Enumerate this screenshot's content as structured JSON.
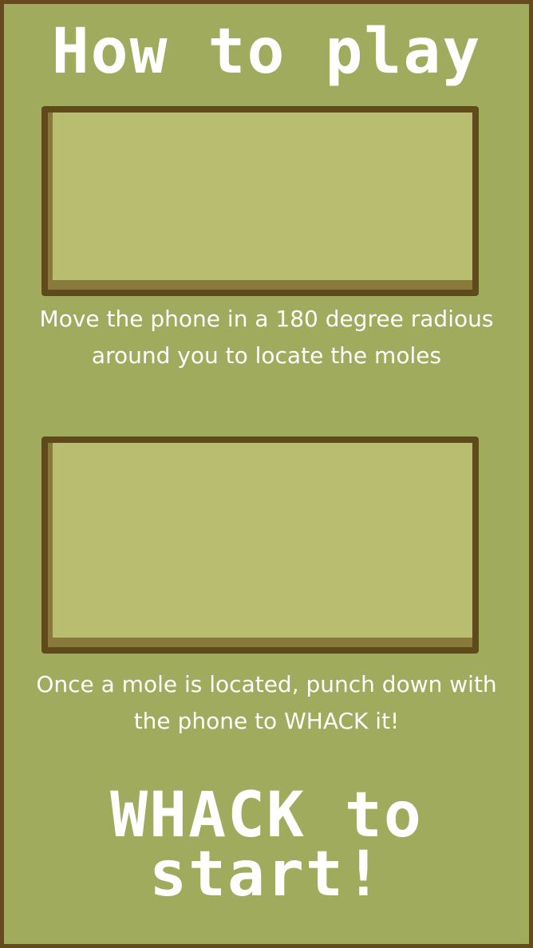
{
  "title": "How to play",
  "steps": [
    {
      "description": "Move the phone in a 180 degree radious around you to locate the moles"
    },
    {
      "description": "Once a mole is located, punch down with the phone to WHACK it!"
    }
  ],
  "start_prompt": "WHACK to start!",
  "colors": {
    "background": "#a0ab5d",
    "border": "#654a1f",
    "panel_fill": "#b9bd6f",
    "panel_shadow": "#8a793c",
    "text": "#ffffff"
  }
}
